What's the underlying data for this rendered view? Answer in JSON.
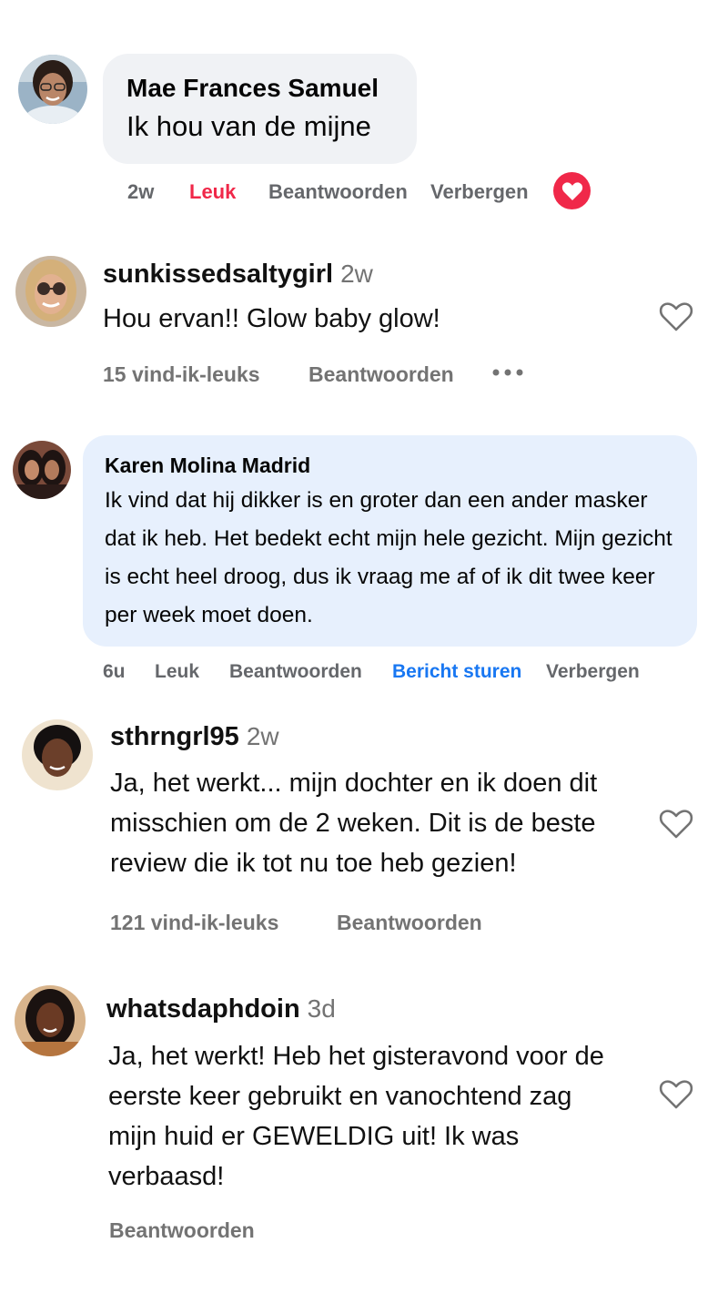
{
  "comments": [
    {
      "author": "Mae Frances Samuel",
      "text": "Ik hou van de mijne",
      "time": "2w",
      "actions": {
        "like": "Leuk",
        "reply": "Beantwoorden",
        "hide": "Verbergen"
      },
      "reaction_icon": "heart-icon",
      "liked": true
    },
    {
      "author": "sunkissedsaltygirl",
      "time": "2w",
      "text": "Hou ervan!! Glow baby glow!",
      "likes": "15 vind-ik-leuks",
      "actions": {
        "reply": "Beantwoorden"
      },
      "more_icon": "more-dots-icon"
    },
    {
      "author": "Karen Molina Madrid",
      "text": "Ik vind dat hij dikker is en groter dan een ander masker dat ik heb. Het bedekt echt mijn hele gezicht. Mijn gezicht is echt heel droog, dus ik vraag me af of ik dit twee keer per week moet doen.",
      "time": "6u",
      "actions": {
        "like": "Leuk",
        "reply": "Beantwoorden",
        "message": "Bericht sturen",
        "hide": "Verbergen"
      }
    },
    {
      "author": "sthrngrl95",
      "time": "2w",
      "text": "Ja, het werkt... mijn dochter en ik doen dit misschien om de 2 weken. Dit is de beste review die ik tot nu toe heb gezien!",
      "likes": "121 vind-ik-leuks",
      "actions": {
        "reply": "Beantwoorden"
      }
    },
    {
      "author": "whatsdaphdoin",
      "time": "3d",
      "text": "Ja, het werkt! Heb het gisteravond voor de eerste keer gebruikt en vanochtend zag mijn huid er GEWELDIG uit! Ik was verbaasd!",
      "actions": {
        "reply": "Beantwoorden"
      }
    }
  ],
  "colors": {
    "like_red": "#f02849",
    "link_blue": "#1877f2",
    "bubble_gray": "#f0f2f5",
    "bubble_blue": "#e7f0fd",
    "meta_gray": "#65676b"
  }
}
